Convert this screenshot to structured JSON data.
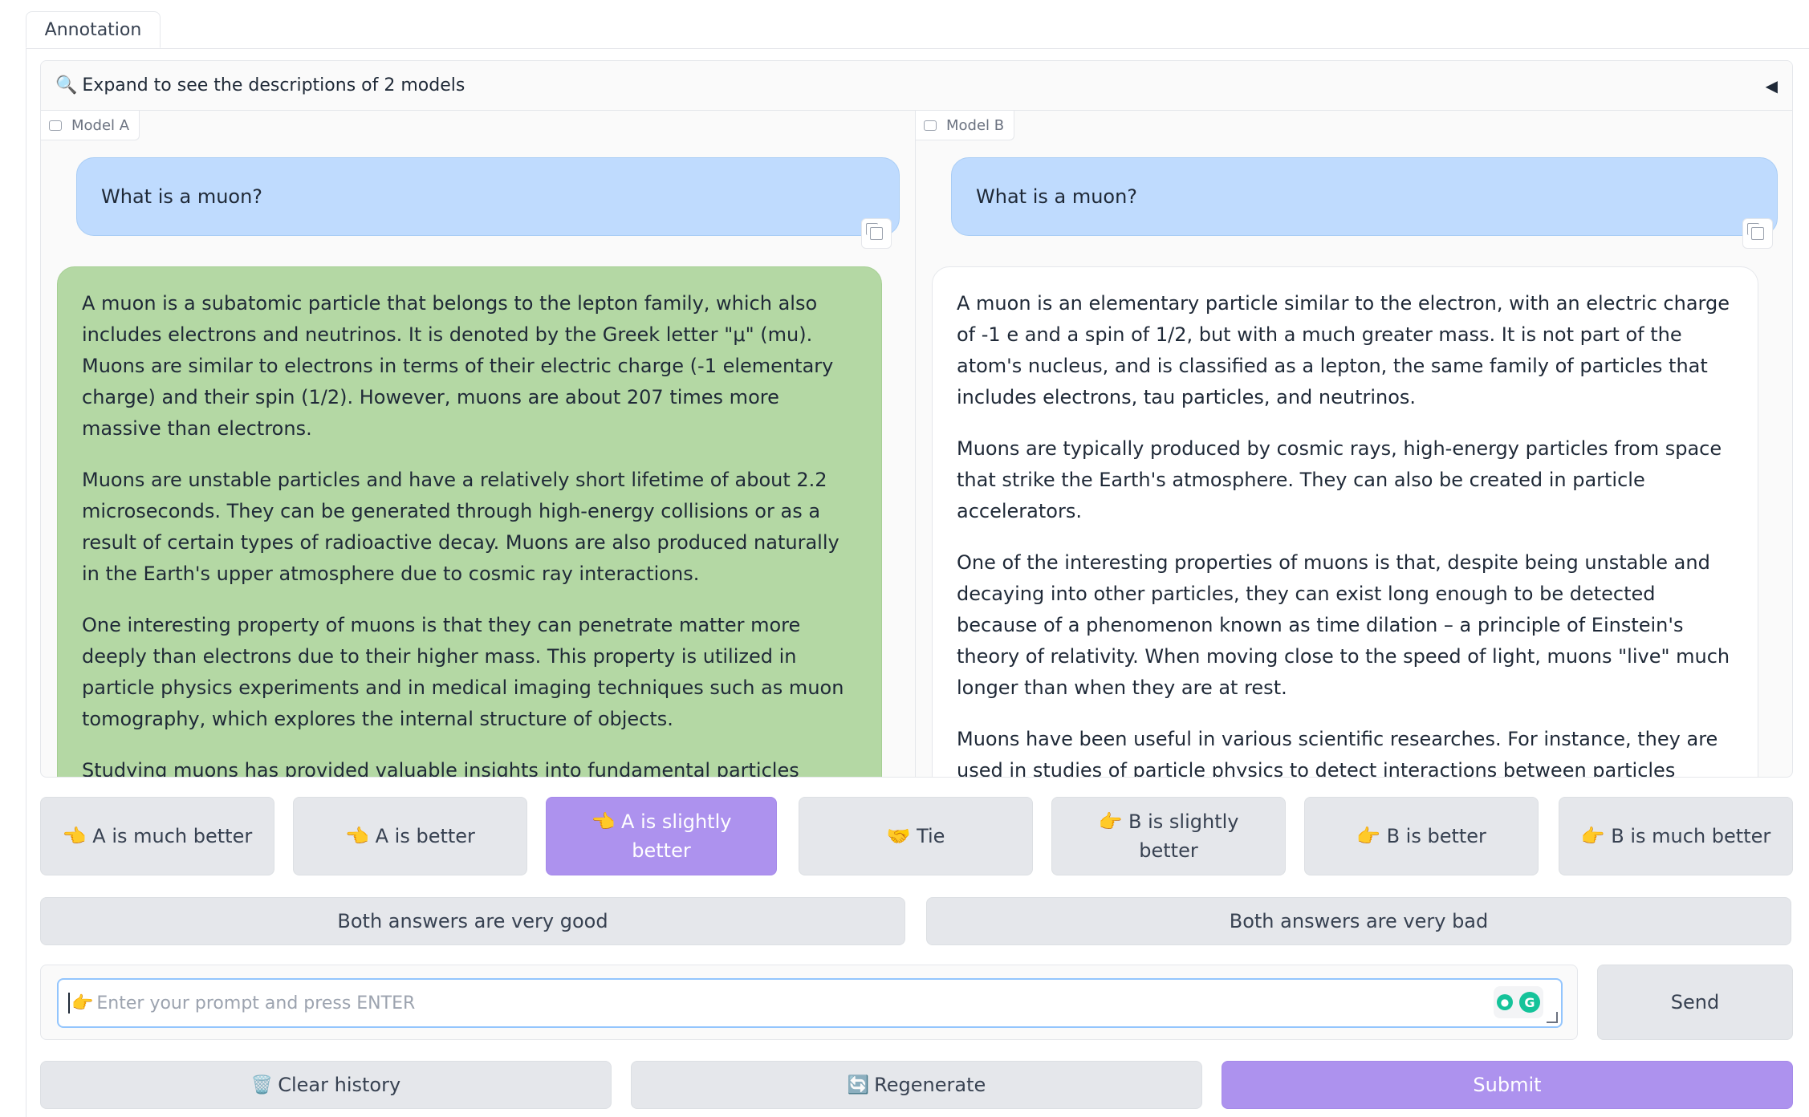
{
  "tabs": [
    {
      "label": "Annotation"
    }
  ],
  "expander": {
    "icon": "🔍",
    "text": "Expand to see the descriptions of 2 models",
    "arrow": "◀"
  },
  "model_a": {
    "label": "Model A",
    "user_message": "What is a muon?",
    "response_paragraphs": [
      "A muon is a subatomic particle that belongs to the lepton family, which also includes electrons and neutrinos. It is denoted by the Greek letter \"μ\" (mu). Muons are similar to electrons in terms of their electric charge (-1 elementary charge) and their spin (1/2). However, muons are about 207 times more massive than electrons.",
      "Muons are unstable particles and have a relatively short lifetime of about 2.2 microseconds. They can be generated through high-energy collisions or as a result of certain types of radioactive decay. Muons are also produced naturally in the Earth's upper atmosphere due to cosmic ray interactions.",
      "One interesting property of muons is that they can penetrate matter more deeply than electrons due to their higher mass. This property is utilized in particle physics experiments and in medical imaging techniques such as muon tomography, which explores the internal structure of objects.",
      "Studying muons has provided valuable insights into fundamental particles"
    ]
  },
  "model_b": {
    "label": "Model B",
    "user_message": "What is a muon?",
    "response_paragraphs": [
      "A muon is an elementary particle similar to the electron, with an electric charge of -1 e and a spin of 1/2, but with a much greater mass. It is not part of the atom's nucleus, and is classified as a lepton, the same family of particles that includes electrons, tau particles, and neutrinos.",
      "Muons are typically produced by cosmic rays, high-energy particles from space that strike the Earth's atmosphere. They can also be created in particle accelerators.",
      "One of the interesting properties of muons is that, despite being unstable and decaying into other particles, they can exist long enough to be detected because of a phenomenon known as time dilation – a principle of Einstein's theory of relativity. When moving close to the speed of light, muons \"live\" much longer than when they are at rest.",
      "Muons have been useful in various scientific researches. For instance, they are used in studies of particle physics to detect interactions between particles"
    ]
  },
  "rating_buttons": [
    {
      "label": "👈 A is much better",
      "selected": false
    },
    {
      "label": "👈 A is better",
      "selected": false
    },
    {
      "label": "👈 A is slightly better",
      "selected": true
    },
    {
      "label": "🤝 Tie",
      "selected": false
    },
    {
      "label": "👉 B is slightly better",
      "selected": false
    },
    {
      "label": "👉 B is better",
      "selected": false
    },
    {
      "label": "👉 B is much better",
      "selected": false
    }
  ],
  "both_buttons": {
    "good": "Both answers are very good",
    "bad": "Both answers are very bad"
  },
  "prompt_input": {
    "icon": "👉",
    "placeholder": "Enter your prompt and press ENTER",
    "value": ""
  },
  "send_label": "Send",
  "bottom_buttons": {
    "clear": {
      "icon": "🗑️",
      "label": "Clear history"
    },
    "regenerate": {
      "icon": "🔄",
      "label": "Regenerate"
    },
    "submit": {
      "label": "Submit"
    }
  },
  "colors": {
    "accent_purple": "#ad92ee",
    "user_bubble": "#bfdbfe",
    "model_a_bubble": "#b4d8a4"
  }
}
